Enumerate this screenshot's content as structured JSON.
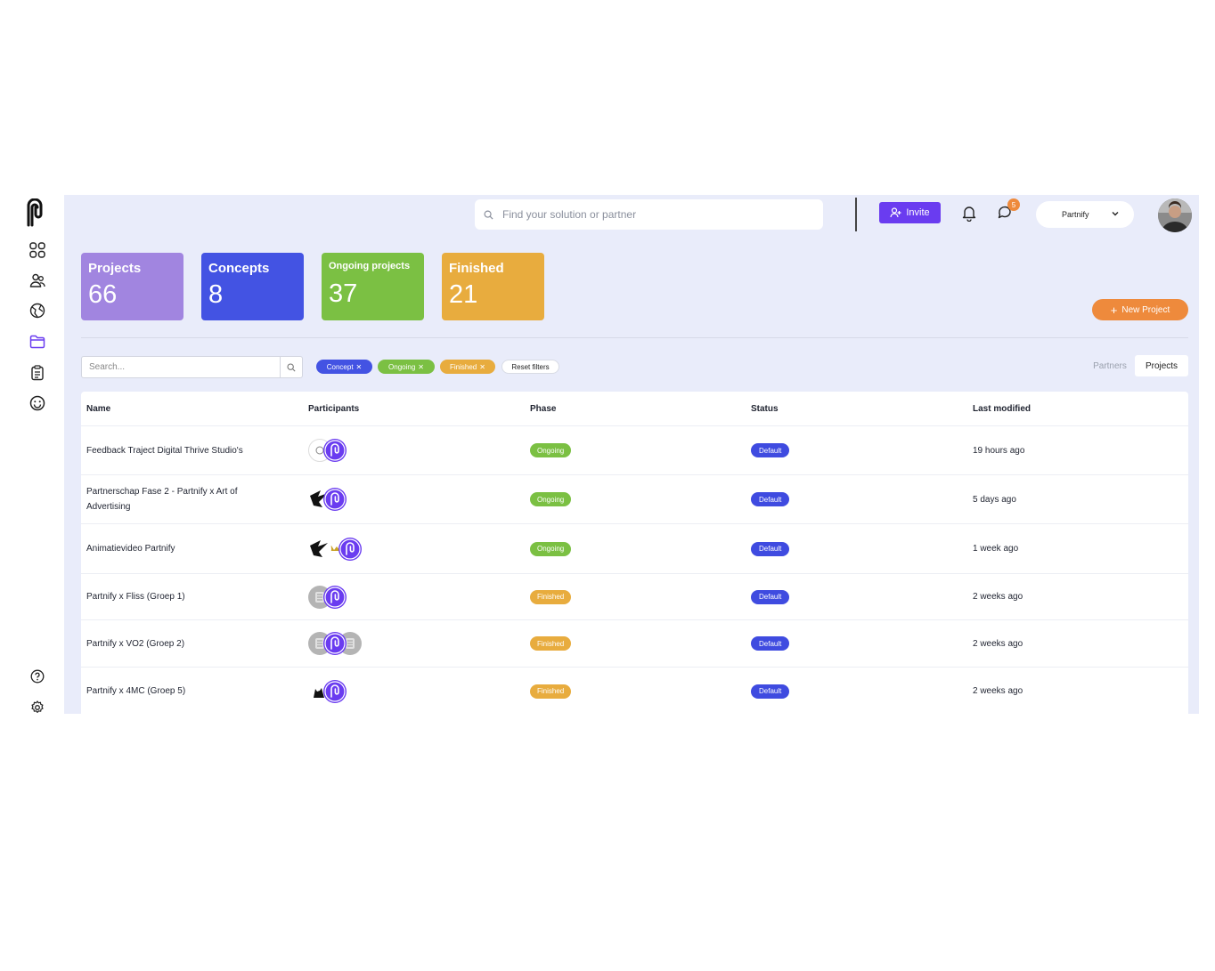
{
  "topbar": {
    "search_placeholder": "Find your solution or partner",
    "invite_label": "Invite",
    "notification_count": "5",
    "org_name": "Partnify"
  },
  "stats": [
    {
      "label": "Projects",
      "value": "66",
      "color": "#a185e0"
    },
    {
      "label": "Concepts",
      "value": "8",
      "color": "#4353e3"
    },
    {
      "label": "Ongoing projects",
      "value": "37",
      "color": "#7bc043"
    },
    {
      "label": "Finished",
      "value": "21",
      "color": "#e8ac3e"
    }
  ],
  "new_project_label": "New Project",
  "filters": {
    "search_placeholder": "Search...",
    "chips": [
      {
        "label": "Concept",
        "color": "#4353e3"
      },
      {
        "label": "Ongoing",
        "color": "#7bc043"
      },
      {
        "label": "Finished",
        "color": "#e8ac3e"
      }
    ],
    "reset_label": "Reset filters",
    "view_toggle": [
      "Partners",
      "Projects"
    ],
    "active_view": "Projects"
  },
  "table": {
    "columns": [
      "Name",
      "Participants",
      "Phase",
      "Status",
      "Last modified"
    ],
    "rows": [
      {
        "name": "Feedback Traject Digital Thrive Studio's",
        "phase": "Ongoing",
        "status": "Default",
        "modified": "19 hours ago"
      },
      {
        "name": "Partnerschap Fase 2 - Partnify x Art of Advertising",
        "phase": "Ongoing",
        "status": "Default",
        "modified": "5 days ago"
      },
      {
        "name": "Animatievideo Partnify",
        "phase": "Ongoing",
        "status": "Default",
        "modified": "1 week ago"
      },
      {
        "name": "Partnify x Fliss (Groep 1)",
        "phase": "Finished",
        "status": "Default",
        "modified": "2 weeks ago"
      },
      {
        "name": "Partnify x VO2 (Groep 2)",
        "phase": "Finished",
        "status": "Default",
        "modified": "2 weeks ago"
      },
      {
        "name": "Partnify x 4MC (Groep 5)",
        "phase": "Finished",
        "status": "Default",
        "modified": "2 weeks ago"
      }
    ]
  },
  "colors": {
    "ongoing": "#7bc043",
    "finished": "#e8ac3e",
    "status_default": "#3f4be0",
    "brand_purple": "#6a3cf0",
    "accent_orange": "#ee8a3c"
  }
}
